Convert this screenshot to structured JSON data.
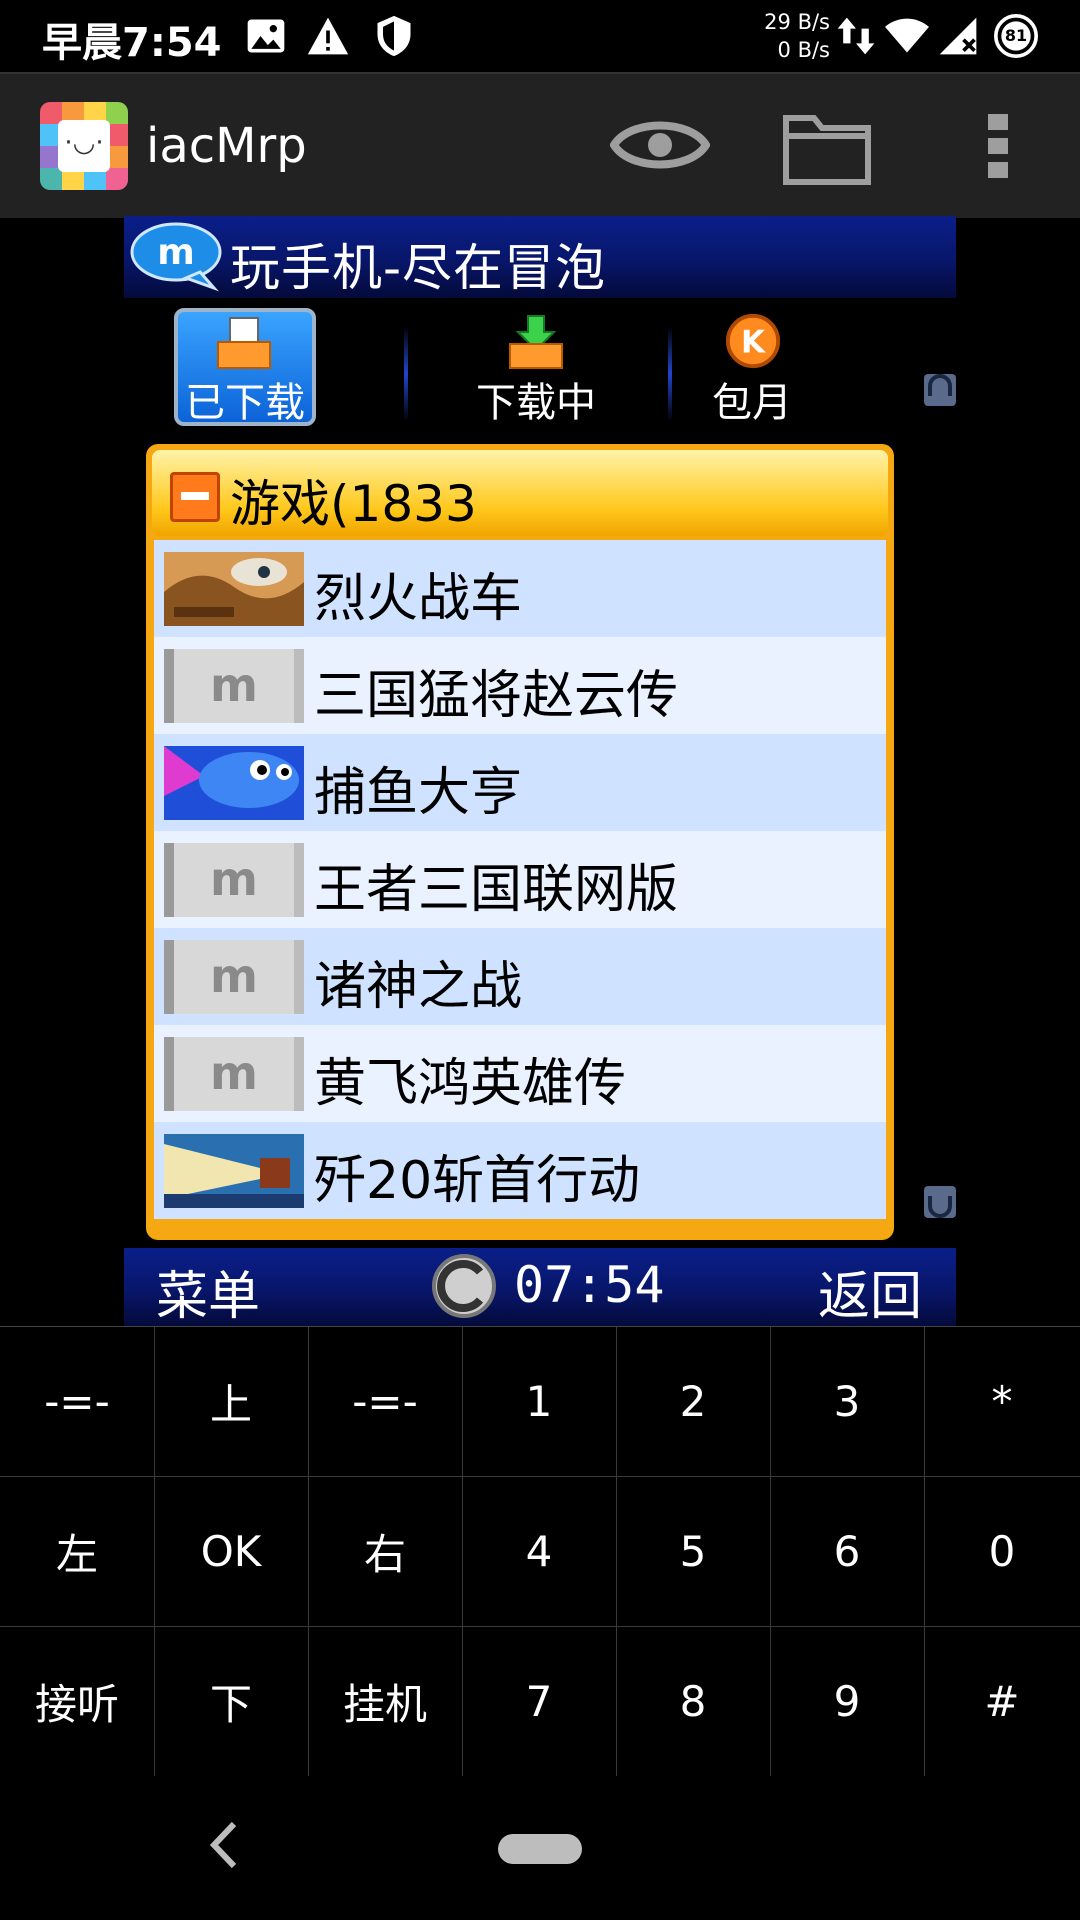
{
  "status_bar": {
    "time": "早晨7:54",
    "speed_up": "29 B/s",
    "speed_down": "0 B/s",
    "battery": "81",
    "icons": [
      "image-icon",
      "warning-icon",
      "shield-icon",
      "data-transfer-icon",
      "wifi-icon",
      "signal-icon",
      "battery-icon"
    ]
  },
  "app_bar": {
    "title": "iacMrp",
    "icons": [
      "app-logo-icon",
      "eye-icon",
      "folder-icon",
      "overflow-menu-icon"
    ]
  },
  "screen": {
    "slogan": "玩手机-尽在冒泡",
    "tabs": [
      {
        "label": "已下载",
        "icon": "downloaded-icon",
        "active": true
      },
      {
        "label": "下载中",
        "icon": "downloading-icon",
        "active": false
      },
      {
        "label": "包月",
        "icon": "k-coin-icon",
        "active": false
      }
    ],
    "list_header": "游戏(1833",
    "items": [
      {
        "label": "烈火战车",
        "thumb": "tank-thumbnail"
      },
      {
        "label": "三国猛将赵云传",
        "thumb": "m-placeholder-thumbnail"
      },
      {
        "label": "捕鱼大亨",
        "thumb": "fish-thumbnail"
      },
      {
        "label": "王者三国联网版",
        "thumb": "m-placeholder-thumbnail"
      },
      {
        "label": "诸神之战",
        "thumb": "m-placeholder-thumbnail"
      },
      {
        "label": "黄飞鸿英雄传",
        "thumb": "m-placeholder-thumbnail"
      },
      {
        "label": "歼20斩首行动",
        "thumb": "jet-thumbnail"
      }
    ],
    "softkey_left": "菜单",
    "clock": "07:54",
    "softkey_right": "返回"
  },
  "keypad": {
    "rows": [
      [
        "-=-",
        "上",
        "-=-",
        "1",
        "2",
        "3",
        "*"
      ],
      [
        "左",
        "OK",
        "右",
        "4",
        "5",
        "6",
        "0"
      ],
      [
        "接听",
        "下",
        "挂机",
        "7",
        "8",
        "9",
        "#"
      ]
    ]
  },
  "colors": {
    "header_blue": "#08166a",
    "list_gold": "#f5a812",
    "row_blue": "#cfe2ff",
    "row_light": "#eaf1ff"
  }
}
